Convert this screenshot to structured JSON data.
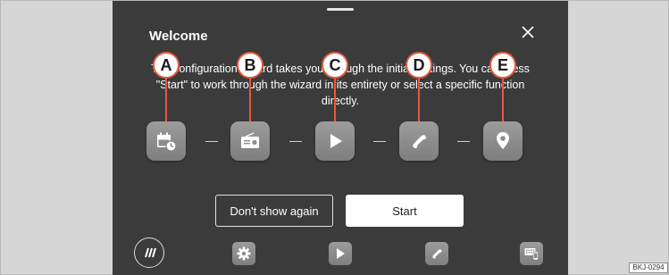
{
  "dialog": {
    "title": "Welcome",
    "description_line1": "The configuration wizard takes you through the initial settings. You can press",
    "description_line2": "\"Start\" to work through the wizard in its entirety or select a specific function",
    "description_line3": "directly.",
    "close_icon": "close-icon"
  },
  "steps": [
    {
      "callout": "A",
      "icon": "calendar-clock-icon"
    },
    {
      "callout": "B",
      "icon": "radio-icon"
    },
    {
      "callout": "C",
      "icon": "play-icon"
    },
    {
      "callout": "D",
      "icon": "phone-icon"
    },
    {
      "callout": "E",
      "icon": "location-pin-icon"
    }
  ],
  "buttons": {
    "dont_show_again": "Don't show again",
    "start": "Start"
  },
  "dock": [
    {
      "icon": "menu-icon"
    },
    {
      "icon": "settings-icon"
    },
    {
      "icon": "media-icon"
    },
    {
      "icon": "phone-icon"
    },
    {
      "icon": "keyboard-phone-icon"
    }
  ],
  "figure_code": "BKJ-0294",
  "colors": {
    "screen_bg": "#3b3b3b",
    "frame_bg": "#d6d6d6",
    "callout_ring": "#e45a3a",
    "icon_tile": "#8c8c8c"
  }
}
